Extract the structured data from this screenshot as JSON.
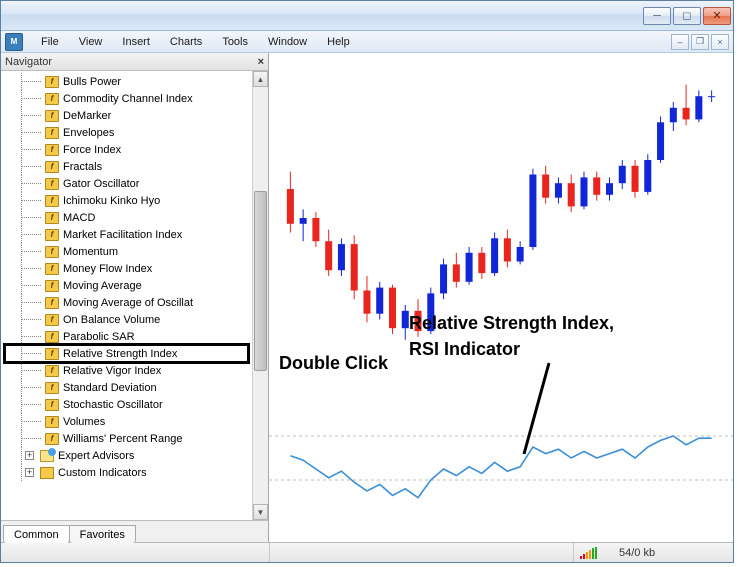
{
  "menubar": [
    "File",
    "View",
    "Insert",
    "Charts",
    "Tools",
    "Window",
    "Help"
  ],
  "navigator": {
    "title": "Navigator",
    "indicators": [
      "Bulls Power",
      "Commodity Channel Index",
      "DeMarker",
      "Envelopes",
      "Force Index",
      "Fractals",
      "Gator Oscillator",
      "Ichimoku Kinko Hyo",
      "MACD",
      "Market Facilitation Index",
      "Momentum",
      "Money Flow Index",
      "Moving Average",
      "Moving Average of Oscillat",
      "On Balance Volume",
      "Parabolic SAR",
      "Relative Strength Index",
      "Relative Vigor Index",
      "Standard Deviation",
      "Stochastic Oscillator",
      "Volumes",
      "Williams' Percent Range"
    ],
    "groups": [
      "Expert Advisors",
      "Custom Indicators"
    ],
    "tabs": [
      "Common",
      "Favorites"
    ],
    "active_tab": 0,
    "highlighted_index": 16
  },
  "annotations": {
    "double_click": "Double Click",
    "rsi_line1": "Relative Strength Index,",
    "rsi_line2": "RSI Indicator"
  },
  "statusbar": {
    "transfer": "54/0 kb"
  },
  "colors": {
    "bull": "#1126d6",
    "bear": "#e8261f",
    "rsi": "#3a8fd6"
  },
  "chart_data": {
    "type": "candlestick_with_indicator",
    "price": {
      "ylim": [
        0,
        100
      ],
      "candles": [
        {
          "x": 0,
          "o": 60,
          "h": 66,
          "l": 45,
          "c": 48,
          "d": "bear"
        },
        {
          "x": 1,
          "o": 48,
          "h": 53,
          "l": 42,
          "c": 50,
          "d": "bull"
        },
        {
          "x": 2,
          "o": 50,
          "h": 52,
          "l": 40,
          "c": 42,
          "d": "bear"
        },
        {
          "x": 3,
          "o": 42,
          "h": 46,
          "l": 30,
          "c": 32,
          "d": "bear"
        },
        {
          "x": 4,
          "o": 32,
          "h": 43,
          "l": 30,
          "c": 41,
          "d": "bull"
        },
        {
          "x": 5,
          "o": 41,
          "h": 44,
          "l": 22,
          "c": 25,
          "d": "bear"
        },
        {
          "x": 6,
          "o": 25,
          "h": 30,
          "l": 14,
          "c": 17,
          "d": "bear"
        },
        {
          "x": 7,
          "o": 17,
          "h": 28,
          "l": 15,
          "c": 26,
          "d": "bull"
        },
        {
          "x": 8,
          "o": 26,
          "h": 27,
          "l": 10,
          "c": 12,
          "d": "bear"
        },
        {
          "x": 9,
          "o": 12,
          "h": 20,
          "l": 8,
          "c": 18,
          "d": "bull"
        },
        {
          "x": 10,
          "o": 18,
          "h": 22,
          "l": 9,
          "c": 11,
          "d": "bear"
        },
        {
          "x": 11,
          "o": 11,
          "h": 26,
          "l": 10,
          "c": 24,
          "d": "bull"
        },
        {
          "x": 12,
          "o": 24,
          "h": 36,
          "l": 22,
          "c": 34,
          "d": "bull"
        },
        {
          "x": 13,
          "o": 34,
          "h": 38,
          "l": 26,
          "c": 28,
          "d": "bear"
        },
        {
          "x": 14,
          "o": 28,
          "h": 40,
          "l": 27,
          "c": 38,
          "d": "bull"
        },
        {
          "x": 15,
          "o": 38,
          "h": 40,
          "l": 29,
          "c": 31,
          "d": "bear"
        },
        {
          "x": 16,
          "o": 31,
          "h": 45,
          "l": 30,
          "c": 43,
          "d": "bull"
        },
        {
          "x": 17,
          "o": 43,
          "h": 46,
          "l": 33,
          "c": 35,
          "d": "bear"
        },
        {
          "x": 18,
          "o": 35,
          "h": 42,
          "l": 34,
          "c": 40,
          "d": "bull"
        },
        {
          "x": 19,
          "o": 40,
          "h": 67,
          "l": 39,
          "c": 65,
          "d": "bull"
        },
        {
          "x": 20,
          "o": 65,
          "h": 68,
          "l": 55,
          "c": 57,
          "d": "bear"
        },
        {
          "x": 21,
          "o": 57,
          "h": 64,
          "l": 55,
          "c": 62,
          "d": "bull"
        },
        {
          "x": 22,
          "o": 62,
          "h": 65,
          "l": 52,
          "c": 54,
          "d": "bear"
        },
        {
          "x": 23,
          "o": 54,
          "h": 66,
          "l": 53,
          "c": 64,
          "d": "bull"
        },
        {
          "x": 24,
          "o": 64,
          "h": 66,
          "l": 56,
          "c": 58,
          "d": "bear"
        },
        {
          "x": 25,
          "o": 58,
          "h": 64,
          "l": 56,
          "c": 62,
          "d": "bull"
        },
        {
          "x": 26,
          "o": 62,
          "h": 70,
          "l": 60,
          "c": 68,
          "d": "bull"
        },
        {
          "x": 27,
          "o": 68,
          "h": 70,
          "l": 57,
          "c": 59,
          "d": "bear"
        },
        {
          "x": 28,
          "o": 59,
          "h": 72,
          "l": 58,
          "c": 70,
          "d": "bull"
        },
        {
          "x": 29,
          "o": 70,
          "h": 85,
          "l": 69,
          "c": 83,
          "d": "bull"
        },
        {
          "x": 30,
          "o": 83,
          "h": 90,
          "l": 80,
          "c": 88,
          "d": "bull"
        },
        {
          "x": 31,
          "o": 88,
          "h": 96,
          "l": 82,
          "c": 84,
          "d": "bear"
        },
        {
          "x": 32,
          "o": 84,
          "h": 94,
          "l": 83,
          "c": 92,
          "d": "bull"
        },
        {
          "x": 33,
          "o": 92,
          "h": 94,
          "l": 90,
          "c": 92,
          "d": "bull"
        }
      ]
    },
    "rsi": {
      "ylim": [
        0,
        100
      ],
      "levels": [
        30,
        70
      ],
      "values": [
        52,
        48,
        40,
        32,
        38,
        28,
        20,
        26,
        16,
        22,
        14,
        30,
        40,
        34,
        42,
        36,
        46,
        38,
        42,
        60,
        54,
        58,
        50,
        56,
        50,
        54,
        58,
        50,
        60,
        66,
        70,
        62,
        68,
        68
      ]
    }
  }
}
